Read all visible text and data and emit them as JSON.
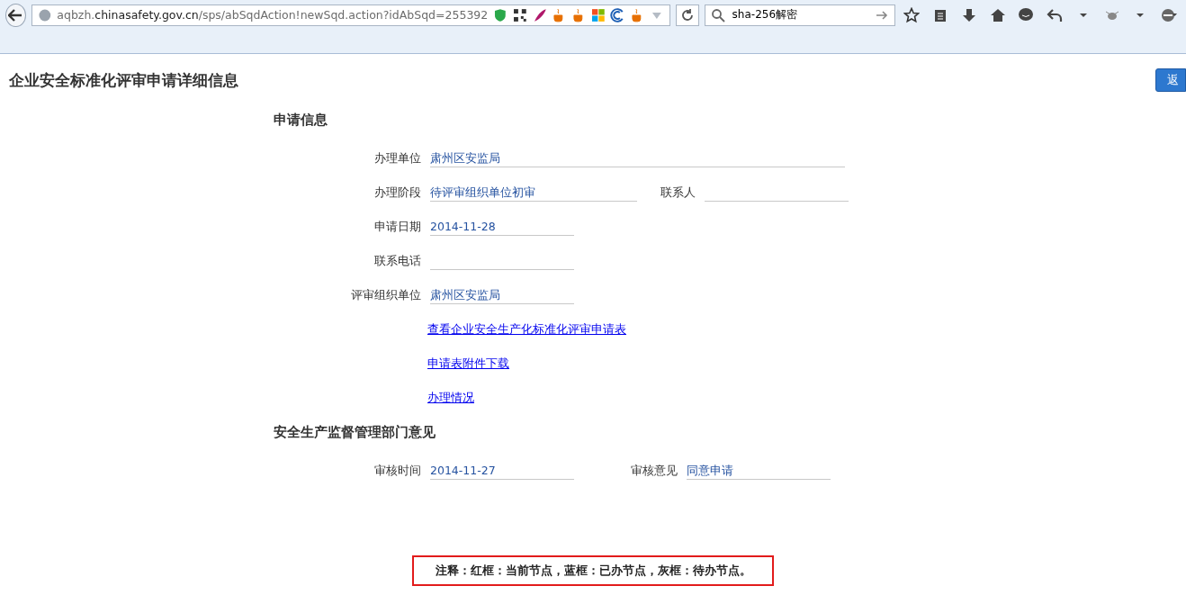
{
  "browser": {
    "url_sub": "aqbzh.",
    "url_domain": "chinasafety.gov.cn",
    "url_path": "/sps/abSqdAction!newSqd.action?idAbSqd=255392",
    "search_value": "sha-256解密"
  },
  "page": {
    "title": "企业安全标准化评审申请详细信息",
    "back_button": "返"
  },
  "sections": [
    {
      "heading": "申请信息",
      "rows": [
        [
          {
            "label": "办理单位",
            "value": "肃州区安监局"
          }
        ],
        [
          {
            "label": "办理阶段",
            "value": "待评审组织单位初审"
          },
          {
            "label": "联系人"
          }
        ],
        [
          {
            "label": "申请日期",
            "value": "2014-11-28"
          }
        ],
        [
          {
            "label": "联系电话"
          }
        ],
        [
          {
            "label": "评审组织单位",
            "value": "肃州区安监局"
          }
        ]
      ],
      "links": [
        "查看企业安全生产化标准化评审申请表",
        "申请表附件下载",
        "办理情况"
      ]
    },
    {
      "heading": "安全生产监督管理部门意见",
      "rows": [
        [
          {
            "label": "审核时间",
            "value": "2014-11-27"
          },
          {
            "label": "审核意见",
            "value": "同意申请"
          }
        ]
      ]
    }
  ],
  "note": "注释：红框：当前节点，蓝框：已办节点，灰框：待办节点。"
}
